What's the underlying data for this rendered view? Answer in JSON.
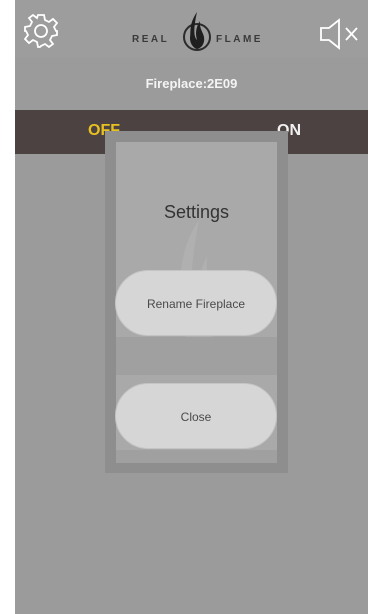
{
  "header": {
    "logo_left": "REAL",
    "logo_right": "FLAME"
  },
  "device": {
    "name": "Fireplace:2E09"
  },
  "power_toggle": {
    "off_label": "OFF",
    "on_label": "ON",
    "active": "OFF",
    "active_color": "#e7c11f"
  },
  "settings_dialog": {
    "title": "Settings",
    "rename_label": "Rename Fireplace",
    "close_label": "Close"
  },
  "icons": {
    "settings": "gear-icon",
    "sound": "speaker-muted-icon",
    "brand": "flame-icon"
  },
  "colors": {
    "toggle_bar": "#4d4242",
    "screen_bg": "#9b9b9b"
  }
}
